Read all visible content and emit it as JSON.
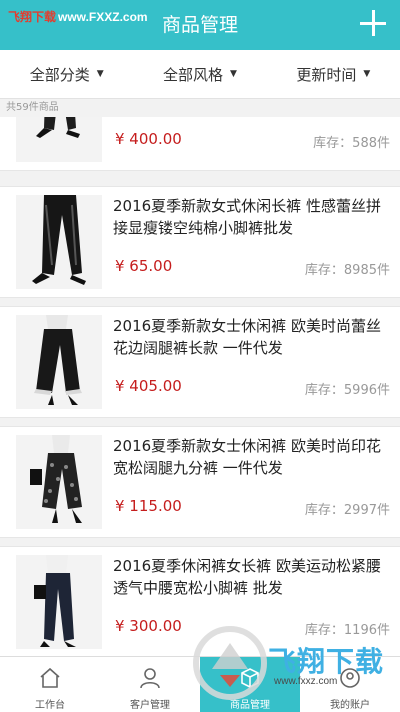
{
  "header": {
    "watermark_a": "飞翔下载",
    "watermark_b": "www.FXXZ.com",
    "title": "商品管理",
    "add_icon": "plus-icon"
  },
  "filters": [
    {
      "label": "全部分类",
      "icon": "caret-down-icon"
    },
    {
      "label": "全部风格",
      "icon": "caret-down-icon"
    },
    {
      "label": "更新时间",
      "icon": "caret-down-icon"
    }
  ],
  "count_text": "共59件商品",
  "products": [
    {
      "name": "",
      "price": "¥ 400.00",
      "stock": "库存：588件"
    },
    {
      "name": "2016夏季新款女式休闲长裤 性感蕾丝拼接显瘦镂空纯棉小脚裤批发",
      "price": "¥ 65.00",
      "stock": "库存：8985件"
    },
    {
      "name": "2016夏季新款女士休闲裤 欧美时尚蕾丝花边阔腿裤长款 一件代发",
      "price": "¥ 405.00",
      "stock": "库存：5996件"
    },
    {
      "name": "2016夏季新款女士休闲裤 欧美时尚印花宽松阔腿九分裤 一件代发",
      "price": "¥ 115.00",
      "stock": "库存：2997件"
    },
    {
      "name": "2016夏季休闲裤女长裤 欧美运动松紧腰透气中腰宽松小脚裤 批发",
      "price": "¥ 300.00",
      "stock": "库存：1196件"
    }
  ],
  "tabs": [
    {
      "label": "工作台",
      "icon": "home-icon",
      "active": false
    },
    {
      "label": "客户管理",
      "icon": "user-icon",
      "active": false
    },
    {
      "label": "商品管理",
      "icon": "box-icon",
      "active": true
    },
    {
      "label": "我的账户",
      "icon": "account-icon",
      "active": false
    }
  ],
  "logo": {
    "text": "飞翔下载",
    "sub": "www.fxxz.com"
  },
  "colors": {
    "accent": "#36c0c9",
    "price": "#c51d1d",
    "logo": "#3fb0e3"
  }
}
